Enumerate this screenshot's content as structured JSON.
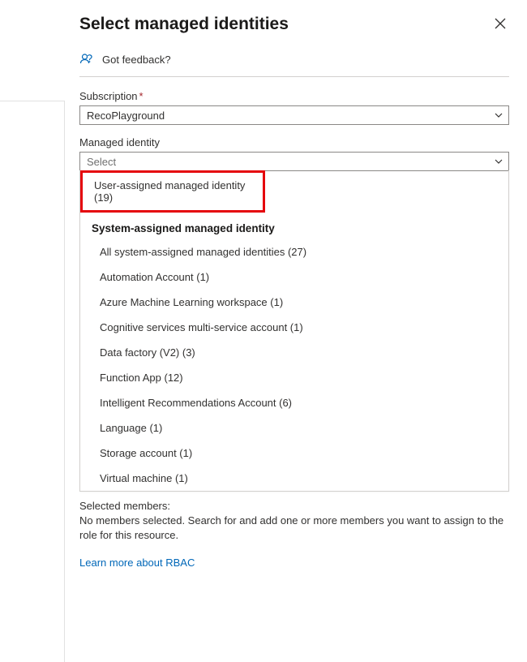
{
  "panel": {
    "title": "Select managed identities"
  },
  "feedback": {
    "text": "Got feedback?"
  },
  "subscription": {
    "label": "Subscription",
    "value": "RecoPlayground"
  },
  "managed_identity": {
    "label": "Managed identity",
    "placeholder": "Select"
  },
  "dropdown": {
    "user_assigned": "User-assigned managed identity (19)",
    "system_assigned_header": "System-assigned managed identity",
    "items": [
      "All system-assigned managed identities (27)",
      "Automation Account (1)",
      "Azure Machine Learning workspace (1)",
      "Cognitive services multi-service account (1)",
      "Data factory (V2) (3)",
      "Function App (12)",
      "Intelligent Recommendations Account (6)",
      "Language (1)",
      "Storage account (1)",
      "Virtual machine (1)"
    ]
  },
  "selected": {
    "label": "Selected members:",
    "text": "No members selected. Search for and add one or more members you want to assign to the role for this resource."
  },
  "learn_more": "Learn more about RBAC"
}
